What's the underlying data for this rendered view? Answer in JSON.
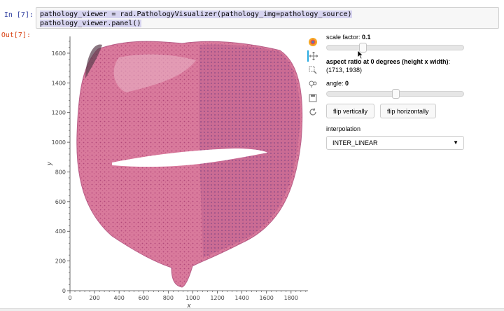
{
  "notebook": {
    "in_prompt": "In [7]:",
    "out_prompt": "Out[7]:",
    "code_lines": [
      "pathology_viewer = rad.PathologyVisualizer(pathology_img=pathology_source)",
      "pathology_viewer.panel()"
    ]
  },
  "plot": {
    "x_ticks": [
      "0",
      "200",
      "400",
      "600",
      "800",
      "1000",
      "1200",
      "1400",
      "1600",
      "1800"
    ],
    "y_ticks": [
      "0",
      "200",
      "400",
      "600",
      "800",
      "1000",
      "1200",
      "1400",
      "1600"
    ],
    "x_label": "x",
    "y_label": "y",
    "tissue_color": "#d86a8f",
    "tissue_light": "#eab0c4"
  },
  "toolbar": {
    "icons": [
      "bokeh-logo-icon",
      "pan-icon",
      "box-zoom-icon",
      "wheel-zoom-icon",
      "save-icon",
      "reset-icon"
    ]
  },
  "widgets": {
    "scale_label": "scale factor:",
    "scale_value": "0.1",
    "scale_fraction": 0.26,
    "aspect_label": "aspect ratio at 0 degrees (height x width)",
    "aspect_value": ": (1713, 1938)",
    "angle_label": "angle:",
    "angle_value": "0",
    "angle_fraction": 0.5,
    "flip_vertical": "flip vertically",
    "flip_horizontal": "flip horizontally",
    "interpolation_label": "interpolation",
    "interpolation_value": "INTER_LINEAR"
  }
}
